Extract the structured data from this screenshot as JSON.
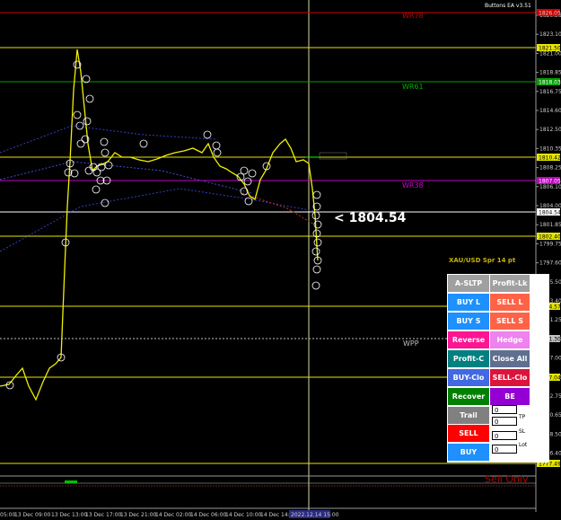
{
  "window": {
    "title": "Buttons EA  v3.51"
  },
  "symbol_info": {
    "spread_text": "XAU/USD Spr 14 pt"
  },
  "current_price": {
    "text": "<  1804.54"
  },
  "lines": {
    "wr78": "WR78",
    "wr61": "WR61",
    "wr38": "WR38",
    "wpp": "WPP",
    "sell_only": "Sell Only"
  },
  "price_axis": {
    "ticks": [
      "1825.25",
      "1823.10",
      "1821.00",
      "1818.85",
      "1816.75",
      "1814.60",
      "1812.50",
      "1810.35",
      "1808.25",
      "1806.10",
      "1804.00",
      "1801.85",
      "1799.75",
      "1797.60",
      "1795.50",
      "1793.40",
      "1791.25",
      "1789.15",
      "1787.00",
      "1784.90",
      "1782.75",
      "1780.65",
      "1778.50",
      "1776.40"
    ],
    "highlight_labels": {
      "wr78": "1826.05",
      "y_line_1": "1821.50",
      "wr61": "1818.03",
      "wr_top": "1810.42",
      "wr38": "1807.05",
      "current": "1804.54",
      "y_line_2": "1802.40",
      "y_line_3": "1794.57",
      "wpp": "1791.30",
      "y_line_4": "1787.04",
      "y_line_5": "1777.49"
    },
    "colors": {
      "wr78": "#d00000",
      "wr61": "#00a000",
      "wr38": "#c000c0",
      "yellow": "#e6e600",
      "current": "#ffffff",
      "wpp": "#c0c0c0"
    }
  },
  "time_axis": {
    "labels": [
      "05:00",
      "13 Dec 09:00",
      "13 Dec 13:00",
      "13 Dec 17:00",
      "13 Dec 21:00",
      "14 Dec 02:00",
      "14 Dec 06:00",
      "14 Dec 10:00",
      "14 Dec 14:00",
      "2022.12.14 15:00"
    ]
  },
  "panel": {
    "buttons": [
      {
        "id": "a-sltp",
        "label": "A-SLTP",
        "color": "#a0a0a0"
      },
      {
        "id": "profit-lk",
        "label": "Profit-Lk",
        "color": "#a0a0a0"
      },
      {
        "id": "buy-l",
        "label": "BUY L",
        "color": "#1e90ff"
      },
      {
        "id": "sell-l",
        "label": "SELL L",
        "color": "#ff6347"
      },
      {
        "id": "buy-s",
        "label": "BUY S",
        "color": "#1e90ff"
      },
      {
        "id": "sell-s",
        "label": "SELL S",
        "color": "#ff6347"
      },
      {
        "id": "reverse",
        "label": "Reverse",
        "color": "#ff1493"
      },
      {
        "id": "hedge",
        "label": "Hedge",
        "color": "#ee82ee"
      },
      {
        "id": "profit-c",
        "label": "Profit-C",
        "color": "#008080"
      },
      {
        "id": "close-all",
        "label": "Close All",
        "color": "#5f6f8f"
      },
      {
        "id": "buy-clo",
        "label": "BUY-Clo",
        "color": "#4169e1"
      },
      {
        "id": "sell-clo",
        "label": "SELL-Clo",
        "color": "#dc143c"
      },
      {
        "id": "recover",
        "label": "Recover",
        "color": "#008000"
      },
      {
        "id": "be",
        "label": "BE",
        "color": "#9400d3"
      },
      {
        "id": "trail",
        "label": "Trail",
        "color": "#808080"
      },
      {
        "id": "sell",
        "label": "SELL",
        "color": "#ff0000"
      },
      {
        "id": "buy",
        "label": "BUY",
        "color": "#1e90ff"
      }
    ],
    "fields": [
      {
        "id": "field-1",
        "value": "0",
        "label": ""
      },
      {
        "id": "tp",
        "value": "0",
        "label": "TP"
      },
      {
        "id": "sl",
        "value": "0",
        "label": "SL"
      },
      {
        "id": "lot",
        "value": "0",
        "label": "Lot"
      }
    ]
  }
}
